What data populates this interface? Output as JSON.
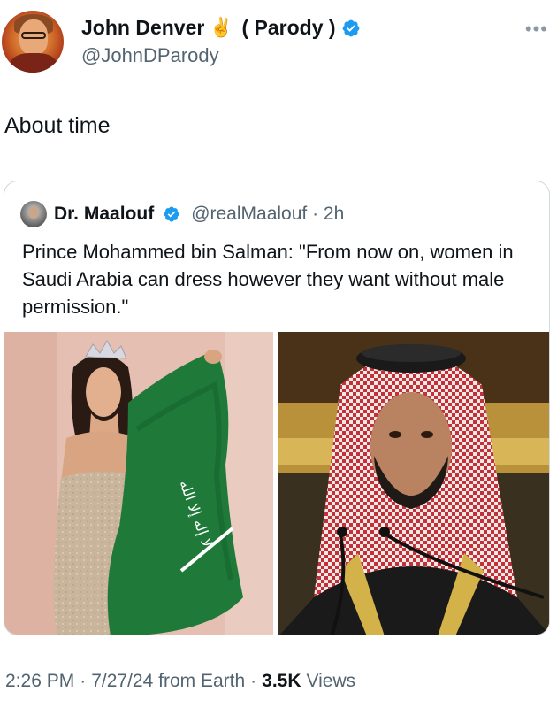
{
  "author": {
    "display_name": "John Denver",
    "emoji": "✌️",
    "parody_label": "( Parody )",
    "handle": "@JohnDParody",
    "avatar_icon": "person-avatar-icon",
    "verified_icon": "verified-badge-icon",
    "more_icon": "more-options-icon"
  },
  "tweet": {
    "text": "About time"
  },
  "quoted_tweet": {
    "display_name": "Dr. Maalouf",
    "handle": "@realMaalouf",
    "separator": "·",
    "time_ago": "2h",
    "text": "Prince Mohammed bin Salman: \"From now on, women in Saudi Arabia can dress however they want without male permission.\"",
    "images": [
      {
        "icon": "photo-woman-with-flag"
      },
      {
        "icon": "photo-man-with-headdress"
      }
    ]
  },
  "footer": {
    "time": "2:26 PM",
    "separator_1": "·",
    "date": "7/27/24 from Earth",
    "separator_2": "·",
    "views_count": "3.5K",
    "views_label": "Views"
  },
  "colors": {
    "verified_blue": "#1d9bf0",
    "text_primary": "#0f1419",
    "text_secondary": "#536471",
    "border": "#cfd9de"
  }
}
